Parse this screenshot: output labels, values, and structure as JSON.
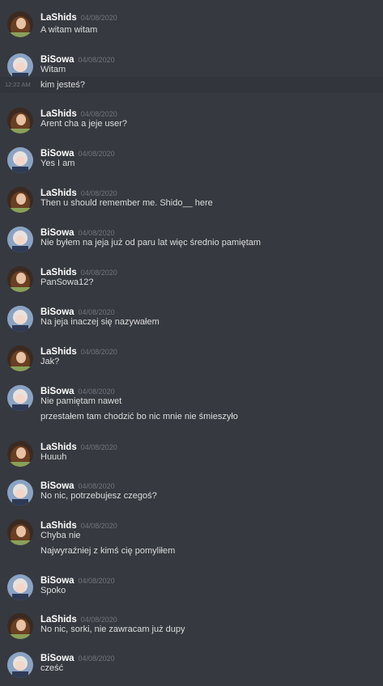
{
  "users": {
    "lashids": {
      "name": "LaShids",
      "avatar": "avatar-lashids"
    },
    "bisowa": {
      "name": "BiSowa",
      "avatar": "avatar-bisowa"
    }
  },
  "messages": [
    {
      "author": "LaShids",
      "time": "04/08/2020",
      "lines": [
        "A witam witam"
      ]
    },
    {
      "author": "BiSowa",
      "time": "04/08/2020",
      "lines": [
        "Witam",
        "kim jesteś?"
      ],
      "hover_time": "12:22 AM"
    },
    {
      "author": "LaShids",
      "time": "04/08/2020",
      "lines": [
        "Arent cha a jeje user?"
      ]
    },
    {
      "author": "BiSowa",
      "time": "04/08/2020",
      "lines": [
        "Yes I am"
      ]
    },
    {
      "author": "LaShids",
      "time": "04/08/2020",
      "lines": [
        "Then u should remember me. Shido__ here"
      ]
    },
    {
      "author": "BiSowa",
      "time": "04/08/2020",
      "lines": [
        "Nie byłem na jeja już od paru lat więc średnio pamiętam"
      ]
    },
    {
      "author": "LaShids",
      "time": "04/08/2020",
      "lines": [
        "PanSowa12?"
      ]
    },
    {
      "author": "BiSowa",
      "time": "04/08/2020",
      "lines": [
        "Na jeja inaczej się nazywałem"
      ]
    },
    {
      "author": "LaShids",
      "time": "04/08/2020",
      "lines": [
        "Jak?"
      ]
    },
    {
      "author": "BiSowa",
      "time": "04/08/2020",
      "lines": [
        "Nie pamiętam nawet",
        "przestałem tam chodzić bo nic mnie nie śmieszyło"
      ]
    },
    {
      "author": "LaShids",
      "time": "04/08/2020",
      "lines": [
        "Huuuh"
      ]
    },
    {
      "author": "BiSowa",
      "time": "04/08/2020",
      "lines": [
        "No nic, potrzebujesz czegoś?"
      ]
    },
    {
      "author": "LaShids",
      "time": "04/08/2020",
      "lines": [
        "Chyba nie",
        "Najwyraźniej z kimś cię pomyliłem"
      ]
    },
    {
      "author": "BiSowa",
      "time": "04/08/2020",
      "lines": [
        "Spoko"
      ]
    },
    {
      "author": "LaShids",
      "time": "04/08/2020",
      "lines": [
        "No nic, sorki, nie zawracam już dupy"
      ]
    },
    {
      "author": "BiSowa",
      "time": "04/08/2020",
      "lines": [
        "cześć"
      ]
    }
  ]
}
